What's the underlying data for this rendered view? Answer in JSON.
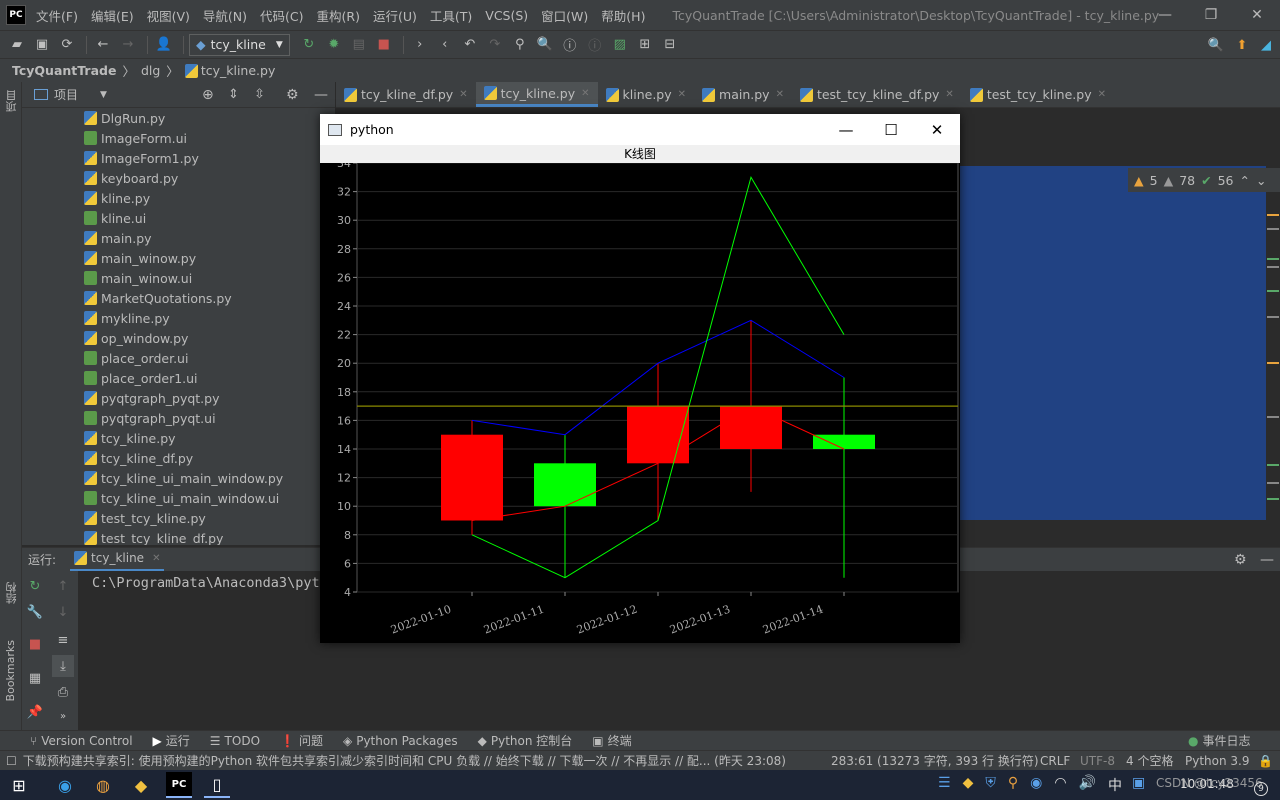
{
  "menubar": {
    "logo": "PC",
    "items": [
      "文件(F)",
      "编辑(E)",
      "视图(V)",
      "导航(N)",
      "代码(C)",
      "重构(R)",
      "运行(U)",
      "工具(T)",
      "VCS(S)",
      "窗口(W)",
      "帮助(H)"
    ],
    "title": "TcyQuantTrade [C:\\Users\\Administrator\\Desktop\\TcyQuantTrade] - tcy_kline.py"
  },
  "toolbar": {
    "run_config": "tcy_kline"
  },
  "breadcrumb": {
    "project": "TcyQuantTrade",
    "folder": "dlg",
    "file": "tcy_kline.py"
  },
  "left_strip": {
    "project": "项目",
    "structure": "结构",
    "bookmarks": "Bookmarks"
  },
  "project_panel": {
    "title": "项目"
  },
  "files": [
    {
      "name": "DlgRun.py",
      "type": "py"
    },
    {
      "name": "ImageForm.ui",
      "type": "ui"
    },
    {
      "name": "ImageForm1.py",
      "type": "py"
    },
    {
      "name": "keyboard.py",
      "type": "py"
    },
    {
      "name": "kline.py",
      "type": "py"
    },
    {
      "name": "kline.ui",
      "type": "ui"
    },
    {
      "name": "main.py",
      "type": "py"
    },
    {
      "name": "main_winow.py",
      "type": "py"
    },
    {
      "name": "main_winow.ui",
      "type": "ui"
    },
    {
      "name": "MarketQuotations.py",
      "type": "py"
    },
    {
      "name": "mykline.py",
      "type": "py"
    },
    {
      "name": "op_window.py",
      "type": "py"
    },
    {
      "name": "place_order.ui",
      "type": "ui"
    },
    {
      "name": "place_order1.ui",
      "type": "ui"
    },
    {
      "name": "pyqtgraph_pyqt.py",
      "type": "py"
    },
    {
      "name": "pyqtgraph_pyqt.ui",
      "type": "ui"
    },
    {
      "name": "tcy_kline.py",
      "type": "py"
    },
    {
      "name": "tcy_kline_df.py",
      "type": "py"
    },
    {
      "name": "tcy_kline_ui_main_window.py",
      "type": "py"
    },
    {
      "name": "tcy_kline_ui_main_window.ui",
      "type": "ui"
    },
    {
      "name": "test_tcy_kline.py",
      "type": "py"
    },
    {
      "name": "test_tcy_kline_df.py",
      "type": "py"
    }
  ],
  "tabs": [
    {
      "label": "tcy_kline_df.py"
    },
    {
      "label": "tcy_kline.py",
      "active": true
    },
    {
      "label": "kline.py"
    },
    {
      "label": "main.py"
    },
    {
      "label": "test_tcy_kline_df.py"
    },
    {
      "label": "test_tcy_kline.py"
    }
  ],
  "inspections": {
    "warnings": "5",
    "weak": "78",
    "ok": "56"
  },
  "run_panel": {
    "label": "运行:",
    "tab": "tcy_kline",
    "console": "C:\\ProgramData\\Anaconda3\\python"
  },
  "bottom_tools": [
    "Version Control",
    "运行",
    "TODO",
    "问题",
    "Python Packages",
    "Python 控制台",
    "终端"
  ],
  "event_log": "事件日志",
  "status": {
    "message": "下载预构建共享索引: 使用预构建的Python 软件包共享索引减少索引时间和 CPU 负载 // 始终下载 // 下载一次 // 不再显示 // 配... (昨天 23:08)",
    "position": "283:61 (13273 字符, 393 行 换行符)",
    "line_sep": "CRLF",
    "encoding": "UTF-8",
    "indent": "4 个空格",
    "interpreter": "Python 3.9"
  },
  "taskbar": {
    "ime": "中",
    "time": "10:01:48",
    "watermark": "CSDN @tcy23456",
    "badge": "9"
  },
  "pywindow": {
    "title": "python",
    "subtitle": "K线图"
  },
  "chart_data": {
    "type": "candlestick",
    "categories": [
      "2022-01-10",
      "2022-01-11",
      "2022-01-12",
      "2022-01-13",
      "2022-01-14"
    ],
    "open": [
      9,
      13,
      13,
      14,
      15
    ],
    "close": [
      15,
      10,
      17,
      17,
      14
    ],
    "high": [
      16,
      15,
      20,
      23,
      19
    ],
    "low": [
      8,
      5,
      9,
      11,
      5
    ],
    "series": [
      {
        "color": "#0000ff",
        "values": [
          16,
          15,
          20,
          23,
          19
        ]
      },
      {
        "color": "#ff0000",
        "values": [
          9,
          10,
          13,
          17,
          14
        ]
      },
      {
        "color": "#00ff00",
        "values": [
          8,
          5,
          9,
          33,
          22
        ]
      }
    ],
    "hline": 17,
    "ylim": [
      4,
      34
    ],
    "yticks": [
      4,
      6,
      8,
      10,
      12,
      14,
      16,
      18,
      20,
      22,
      24,
      26,
      28,
      30,
      32,
      34
    ],
    "colors": {
      "up": "#ff0000",
      "down": "#00ff00",
      "hline": "#8a8a00"
    }
  }
}
